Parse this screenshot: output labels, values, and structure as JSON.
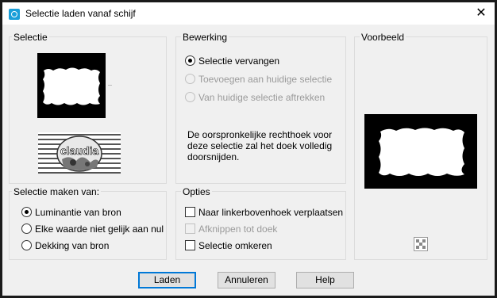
{
  "window": {
    "title": "Selectie laden vanaf schijf",
    "close_symbol": "✕"
  },
  "selectie": {
    "title": "Selectie",
    "thumbnail_text": "claudia"
  },
  "bewerking": {
    "title": "Bewerking",
    "options": [
      {
        "label": "Selectie vervangen",
        "checked": true,
        "enabled": true
      },
      {
        "label": "Toevoegen aan huidige selectie",
        "checked": false,
        "enabled": false
      },
      {
        "label": "Van huidige selectie aftrekken",
        "checked": false,
        "enabled": false
      }
    ],
    "description": "De oorspronkelijke rechthoek voor deze selectie zal het doek volledig doorsnijden."
  },
  "voorbeeld": {
    "title": "Voorbeeld"
  },
  "selectie_maken": {
    "title": "Selectie maken van:",
    "options": [
      {
        "label": "Luminantie van bron",
        "checked": true
      },
      {
        "label": "Elke waarde niet gelijk aan nul",
        "checked": false
      },
      {
        "label": "Dekking van bron",
        "checked": false
      }
    ]
  },
  "opties": {
    "title": "Opties",
    "options": [
      {
        "label": "Naar linkerbovenhoek verplaatsen",
        "checked": false,
        "enabled": true
      },
      {
        "label": "Afknippen tot doek",
        "checked": false,
        "enabled": false
      },
      {
        "label": "Selectie omkeren",
        "checked": false,
        "enabled": true
      }
    ]
  },
  "buttons": {
    "load": "Laden",
    "cancel": "Annuleren",
    "help": "Help"
  },
  "colors": {
    "accent": "#0078d7",
    "icon": "#1a9fd9",
    "background": "#f0f0f0"
  }
}
